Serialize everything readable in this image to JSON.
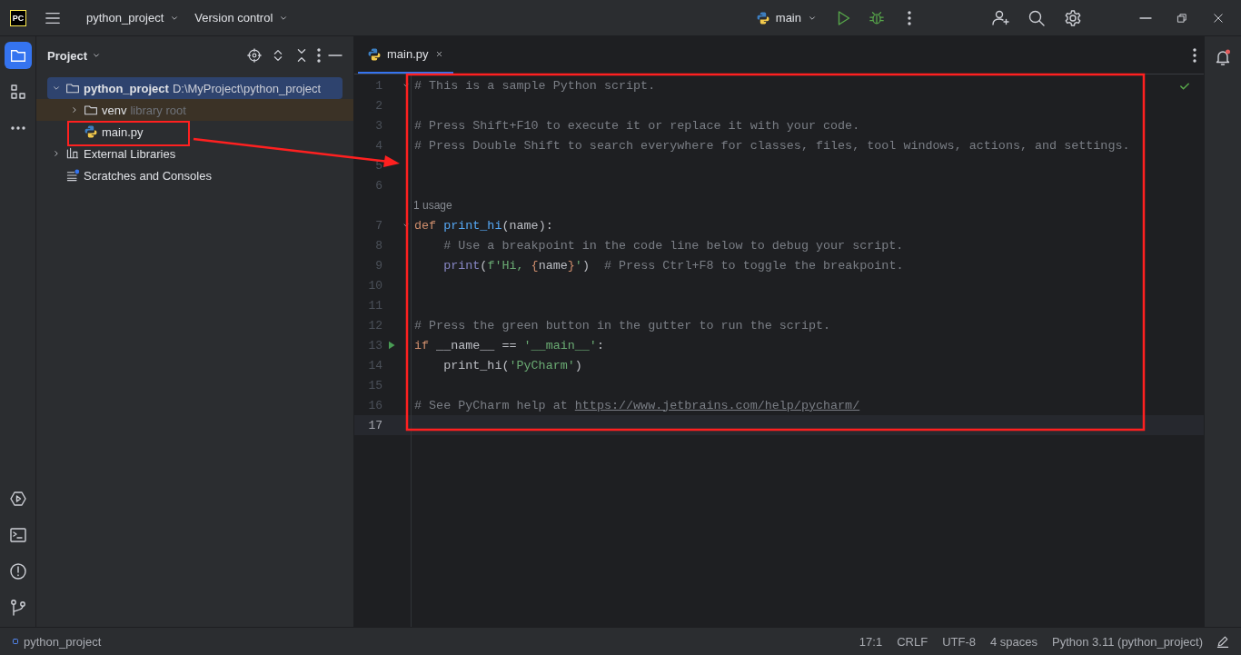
{
  "title_bar": {
    "logo": "PC",
    "project_menu": "python_project",
    "vcs_menu": "Version control",
    "run_config": "main"
  },
  "project_panel": {
    "title": "Project",
    "tree": [
      {
        "label": "python_project",
        "hint": "D:\\MyProject\\python_project",
        "kind": "folder",
        "selected": true,
        "expanded": true,
        "children": [
          {
            "label": "venv",
            "hint": "library root",
            "kind": "library-folder",
            "selected": false,
            "expanded": false
          },
          {
            "label": "main.py",
            "kind": "python-file",
            "selected": false
          }
        ]
      },
      {
        "label": "External Libraries",
        "kind": "libraries",
        "selected": false,
        "expanded": false
      },
      {
        "label": "Scratches and Consoles",
        "kind": "scratches",
        "selected": false
      }
    ]
  },
  "editor": {
    "tabs": [
      {
        "label": "main.py",
        "selected": true
      }
    ],
    "lines": [
      {
        "number": "1",
        "fold": true,
        "tokens": [
          {
            "kind": "comment",
            "text": "# This is a sample Python script."
          }
        ]
      },
      {
        "number": "2"
      },
      {
        "number": "3",
        "tokens": [
          {
            "kind": "comment",
            "text": "# Press Shift+F10 to execute it or replace it with your code."
          }
        ]
      },
      {
        "number": "4",
        "tokens": [
          {
            "kind": "comment",
            "text": "# Press Double Shift to search everywhere for classes, files, tool windows, actions, and settings."
          }
        ]
      },
      {
        "number": "5"
      },
      {
        "number": "6"
      },
      {
        "kind": "inlay",
        "text": "1 usage"
      },
      {
        "number": "7",
        "fold": true,
        "tokens": [
          {
            "kind": "keyword",
            "text": "def "
          },
          {
            "kind": "function",
            "text": "print_hi"
          },
          {
            "kind": "plain",
            "text": "(name):"
          }
        ]
      },
      {
        "number": "8",
        "tokens": [
          {
            "kind": "comment",
            "text": "    # Use a breakpoint in the code line below to debug your script."
          }
        ]
      },
      {
        "number": "9",
        "tokens": [
          {
            "kind": "builtin",
            "text": "    print"
          },
          {
            "kind": "plain",
            "text": "("
          },
          {
            "kind": "string",
            "text": "f'Hi, "
          },
          {
            "kind": "brace",
            "text": "{"
          },
          {
            "kind": "plain",
            "text": "name"
          },
          {
            "kind": "brace",
            "text": "}"
          },
          {
            "kind": "string",
            "text": "'"
          },
          {
            "kind": "plain",
            "text": ")  "
          },
          {
            "kind": "comment",
            "text": "# Press Ctrl+F8 to toggle the breakpoint."
          }
        ]
      },
      {
        "number": "10"
      },
      {
        "number": "11"
      },
      {
        "number": "12",
        "tokens": [
          {
            "kind": "comment",
            "text": "# Press the green button in the gutter to run the script."
          }
        ]
      },
      {
        "number": "13",
        "run": true,
        "tokens": [
          {
            "kind": "keyword",
            "text": "if "
          },
          {
            "kind": "plain",
            "text": "__name__ == "
          },
          {
            "kind": "string",
            "text": "'__main__'"
          },
          {
            "kind": "plain",
            "text": ":"
          }
        ]
      },
      {
        "number": "14",
        "tokens": [
          {
            "kind": "plain",
            "text": "    print_hi("
          },
          {
            "kind": "string",
            "text": "'PyCharm'"
          },
          {
            "kind": "plain",
            "text": ")"
          }
        ]
      },
      {
        "number": "15"
      },
      {
        "number": "16",
        "tokens": [
          {
            "kind": "comment",
            "text": "# See PyCharm help at "
          },
          {
            "kind": "link",
            "text": "https://www.jetbrains.com/help/pycharm/"
          }
        ]
      },
      {
        "number": "17",
        "current": true
      }
    ]
  },
  "status_bar": {
    "breadcrumb": "python_project",
    "items": [
      "17:1",
      "CRLF",
      "UTF-8",
      "4 spaces",
      "Python 3.11 (python_project)"
    ]
  }
}
